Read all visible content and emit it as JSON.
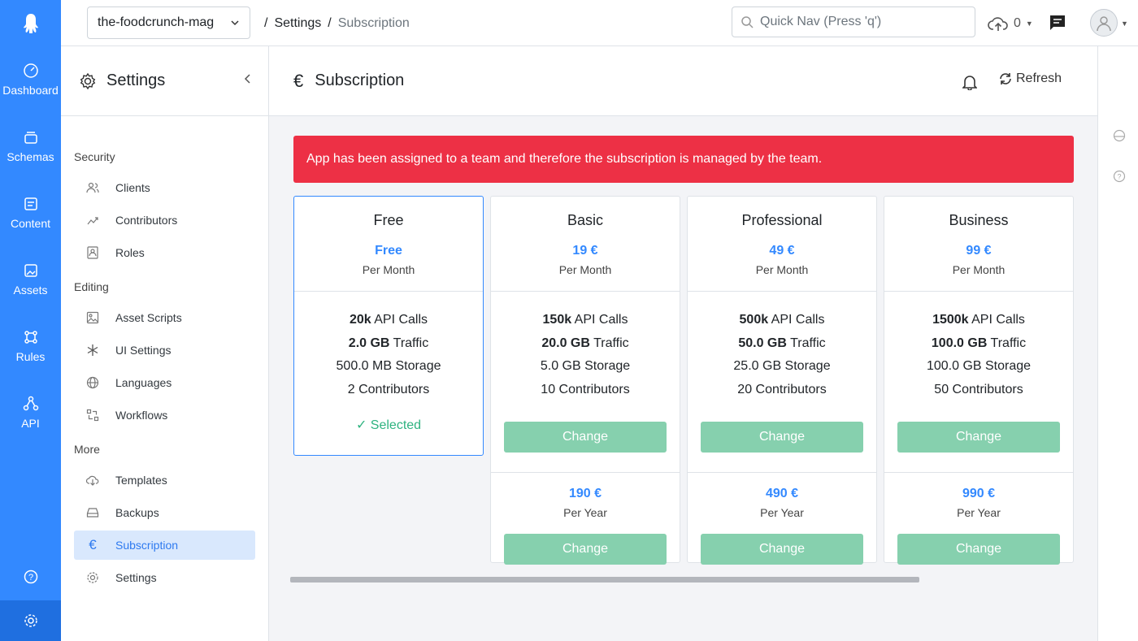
{
  "primary_nav": {
    "items": [
      {
        "label": "Dashboard",
        "icon": "dashboard-icon"
      },
      {
        "label": "Schemas",
        "icon": "schemas-icon"
      },
      {
        "label": "Content",
        "icon": "content-icon"
      },
      {
        "label": "Assets",
        "icon": "assets-icon"
      },
      {
        "label": "Rules",
        "icon": "rules-icon"
      },
      {
        "label": "API",
        "icon": "api-icon"
      }
    ],
    "accent": "#3389ff"
  },
  "topbar": {
    "app_name": "the-foodcrunch-mag",
    "breadcrumb": [
      "Settings",
      "Subscription"
    ],
    "search_placeholder": "Quick Nav (Press 'q')",
    "upload_count": "0"
  },
  "sidebar": {
    "title": "Settings",
    "sections": [
      {
        "title": "Security",
        "items": [
          "Clients",
          "Contributors",
          "Roles"
        ]
      },
      {
        "title": "Editing",
        "items": [
          "Asset Scripts",
          "UI Settings",
          "Languages",
          "Workflows"
        ]
      },
      {
        "title": "More",
        "items": [
          "Templates",
          "Backups",
          "Subscription",
          "Settings"
        ]
      }
    ],
    "active_item": "Subscription"
  },
  "content_header": {
    "title": "Subscription",
    "refresh_label": "Refresh"
  },
  "alert": {
    "text": "App has been assigned to a team and therefore the subscription is managed by the team.",
    "color": "#ed3045"
  },
  "plans": [
    {
      "name": "Free",
      "price": "Free",
      "period": "Per Month",
      "api_calls": "20k",
      "api_calls_label": "API Calls",
      "traffic": "2.0 GB",
      "traffic_label": "Traffic",
      "storage": "500.0 MB Storage",
      "contributors": "2 Contributors",
      "selected_label": "✓ Selected"
    },
    {
      "name": "Basic",
      "price": "19 €",
      "period": "Per Month",
      "api_calls": "150k",
      "api_calls_label": "API Calls",
      "traffic": "20.0 GB",
      "traffic_label": "Traffic",
      "storage": "5.0 GB Storage",
      "contributors": "10 Contributors",
      "change_label": "Change",
      "yearly_price": "190 €",
      "yearly_period": "Per Year",
      "yearly_change_label": "Change"
    },
    {
      "name": "Professional",
      "price": "49 €",
      "period": "Per Month",
      "api_calls": "500k",
      "api_calls_label": "API Calls",
      "traffic": "50.0 GB",
      "traffic_label": "Traffic",
      "storage": "25.0 GB Storage",
      "contributors": "20 Contributors",
      "change_label": "Change",
      "yearly_price": "490 €",
      "yearly_period": "Per Year",
      "yearly_change_label": "Change"
    },
    {
      "name": "Business",
      "price": "99 €",
      "period": "Per Month",
      "api_calls": "1500k",
      "api_calls_label": "API Calls",
      "traffic": "100.0 GB",
      "traffic_label": "Traffic",
      "storage": "100.0 GB Storage",
      "contributors": "50 Contributors",
      "change_label": "Change",
      "yearly_price": "990 €",
      "yearly_period": "Per Year",
      "yearly_change_label": "Change"
    }
  ]
}
